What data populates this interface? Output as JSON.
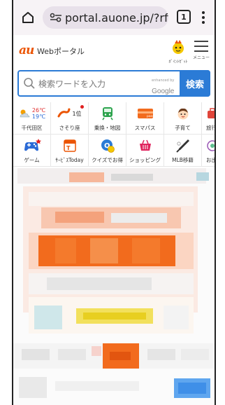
{
  "browser": {
    "url": "portal.auone.jp/?rf:",
    "tab_count": "1"
  },
  "header": {
    "logo_brand": "au",
    "logo_suffix": "Webポータル",
    "points_label": "ﾎﾟｲﾝﾄｾﾞｯﾄ",
    "menu_label": "メニュー"
  },
  "search": {
    "placeholder": "検索ワードを入力",
    "powered_by": "enhanced by",
    "powered_brand": "Google",
    "button_label": "検索"
  },
  "weather": {
    "high": "26℃",
    "low": "19℃"
  },
  "fortune_rank": "1位",
  "shortcuts_row1": [
    {
      "label": "千代田区"
    },
    {
      "label": "さそり座"
    },
    {
      "label": "乗換・地図"
    },
    {
      "label": "スマパス"
    },
    {
      "label": "子育て"
    },
    {
      "label": "旅行"
    }
  ],
  "shortcuts_row2": [
    {
      "label": "ゲーム"
    },
    {
      "label": "ｻｰﾋﾞｽToday"
    },
    {
      "label": "クイズでお得"
    },
    {
      "label": "ショッピング"
    },
    {
      "label": "MLB移籍"
    },
    {
      "label": "お出かけ"
    }
  ],
  "colors": {
    "accent_orange": "#eb5505",
    "search_blue": "#2b7bd6"
  }
}
